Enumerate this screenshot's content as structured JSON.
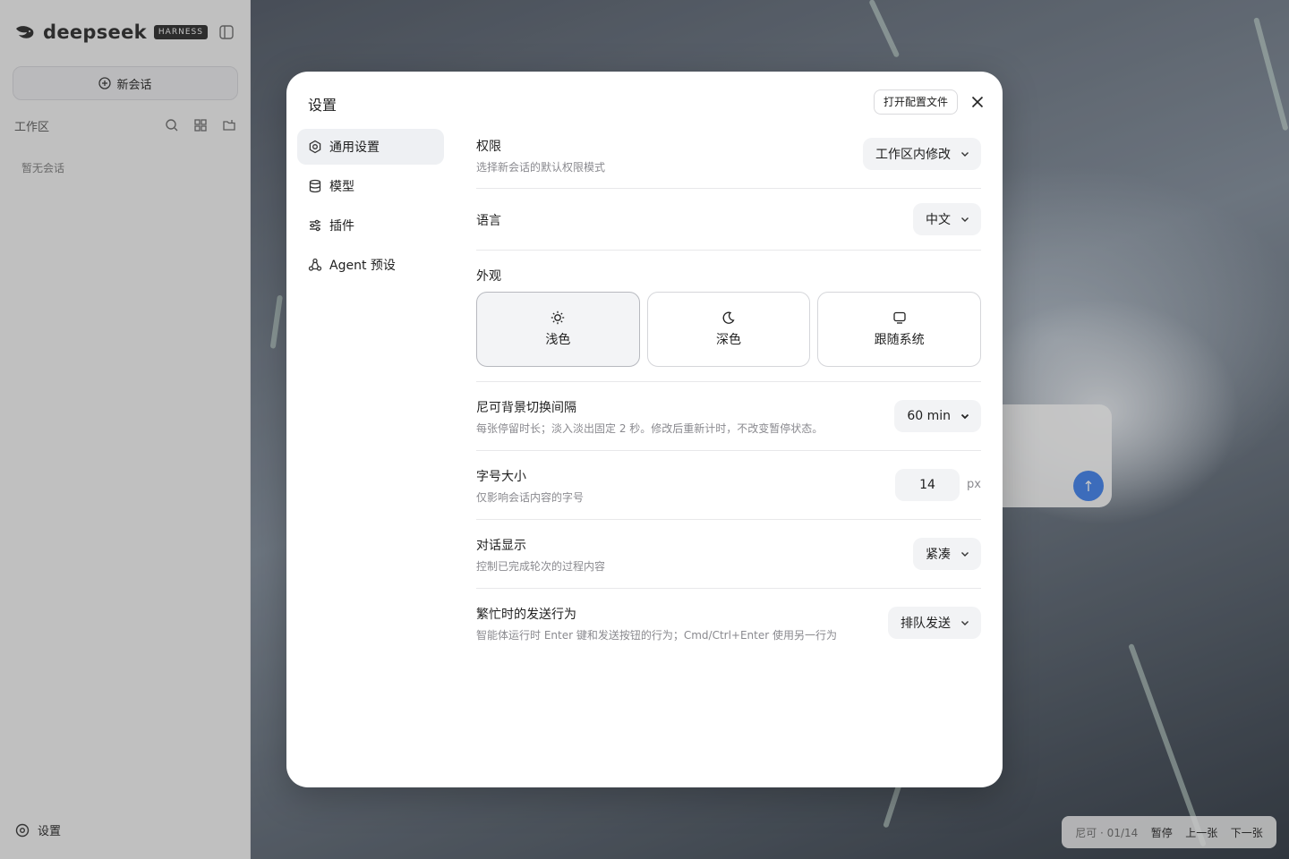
{
  "app": {
    "logo_text": "deepseek",
    "logo_badge": "HARNESS",
    "new_chat_label": "新会话",
    "workspace_label": "工作区",
    "empty_label": "暂无会话",
    "settings_label": "设置"
  },
  "pager": {
    "counter": "尼可 · 01/14",
    "pause_label": "暂停",
    "prev_label": "上一张",
    "next_label": "下一张"
  },
  "settings": {
    "title": "设置",
    "open_config_label": "打开配置文件",
    "nav": [
      {
        "label": "通用设置",
        "icon": "gear-icon"
      },
      {
        "label": "模型",
        "icon": "database-icon"
      },
      {
        "label": "插件",
        "icon": "sliders-icon"
      },
      {
        "label": "Agent 预设",
        "icon": "agent-icon"
      }
    ],
    "permission": {
      "title": "权限",
      "desc": "选择新会话的默认权限模式",
      "value": "工作区内修改"
    },
    "language": {
      "title": "语言",
      "value": "中文"
    },
    "appearance": {
      "title": "外观",
      "options": [
        {
          "label": "浅色",
          "icon": "sun-icon"
        },
        {
          "label": "深色",
          "icon": "moon-icon"
        },
        {
          "label": "跟随系统",
          "icon": "monitor-icon"
        }
      ],
      "selected": "浅色"
    },
    "bg_interval": {
      "title": "尼可背景切换间隔",
      "desc": "每张停留时长；淡入淡出固定 2 秒。修改后重新计时，不改变暂停状态。",
      "value": "60 min"
    },
    "font_size": {
      "title": "字号大小",
      "desc": "仅影响会话内容的字号",
      "value": "14",
      "unit": "px"
    },
    "dialog_display": {
      "title": "对话显示",
      "desc": "控制已完成轮次的过程内容",
      "value": "紧凑"
    },
    "busy_send": {
      "title": "繁忙时的发送行为",
      "desc": "智能体运行时 Enter 键和发送按钮的行为；Cmd/Ctrl+Enter 使用另一行为",
      "value": "排队发送"
    }
  }
}
